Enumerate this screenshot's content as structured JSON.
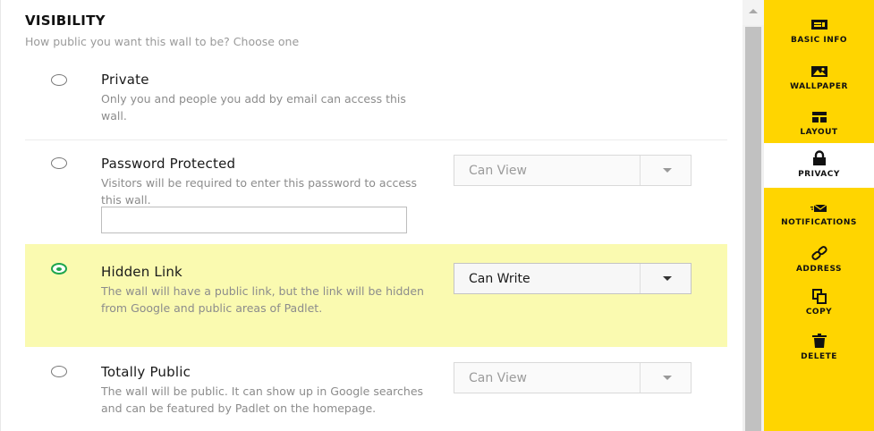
{
  "visibility": {
    "title": "VISIBILITY",
    "subtitle": "How public you want this wall to be? Choose one"
  },
  "options": [
    {
      "title": "Private",
      "description": "Only you and people you add by email can access this wall.",
      "selected": false
    },
    {
      "title": "Password Protected",
      "description": "Visitors will be required to enter this password to access this wall.",
      "selected": false,
      "permission": "Can View",
      "password_value": ""
    },
    {
      "title": "Hidden Link",
      "description": "The wall will have a public link, but the link will be hidden from Google and public areas of Padlet.",
      "selected": true,
      "permission": "Can Write"
    },
    {
      "title": "Totally Public",
      "description": "The wall will be public. It can show up in Google searches and can be featured by Padlet on the homepage.",
      "selected": false,
      "permission": "Can View"
    }
  ],
  "sidebar": {
    "items": [
      {
        "label": "BASIC INFO",
        "icon": "basic-info-icon"
      },
      {
        "label": "WALLPAPER",
        "icon": "wallpaper-icon"
      },
      {
        "label": "LAYOUT",
        "icon": "layout-icon"
      },
      {
        "label": "PRIVACY",
        "icon": "lock-icon",
        "active": true
      },
      {
        "label": "NOTIFICATIONS",
        "icon": "envelope-icon"
      },
      {
        "label": "ADDRESS",
        "icon": "link-icon"
      },
      {
        "label": "COPY",
        "icon": "copy-icon"
      },
      {
        "label": "DELETE",
        "icon": "trash-icon"
      }
    ]
  },
  "colors": {
    "sidebar_bg": "#ffd500",
    "highlight_bg": "#fafab0",
    "radio_selected": "#1fa64d"
  }
}
